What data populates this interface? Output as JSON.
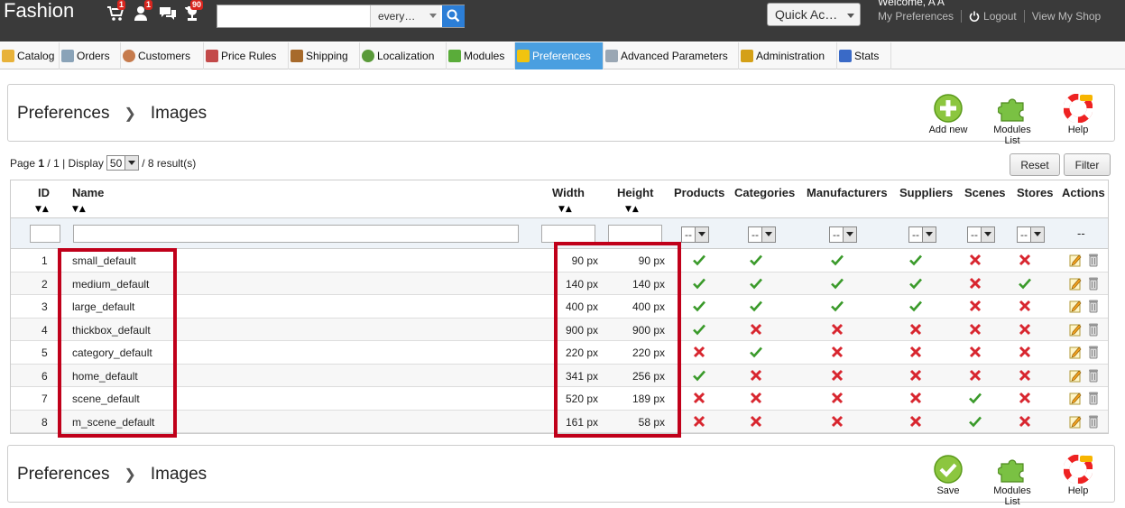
{
  "topbar": {
    "shop_name": "Fashion",
    "notifications": [
      {
        "icon": "cart-icon",
        "count": "1"
      },
      {
        "icon": "customer-icon",
        "count": "1"
      },
      {
        "icon": "message-icon",
        "count": ""
      },
      {
        "icon": "trophy-icon",
        "count": "90"
      }
    ],
    "search_value": "",
    "search_scope": "every…",
    "quick_access": "Quick Ac…",
    "welcome": "Welcome, A A",
    "my_preferences": "My Preferences",
    "logout": "Logout",
    "view_shop": "View My Shop"
  },
  "menu": [
    {
      "label": "Catalog",
      "color": "#e8b23a"
    },
    {
      "label": "Orders",
      "color": "#8aa3b8"
    },
    {
      "label": "Customers",
      "color": "#c67b4d"
    },
    {
      "label": "Price Rules",
      "color": "#c34a4a"
    },
    {
      "label": "Shipping",
      "color": "#a76a2b"
    },
    {
      "label": "Localization",
      "color": "#5a9a3a"
    },
    {
      "label": "Modules",
      "color": "#5aac3a"
    },
    {
      "label": "Preferences",
      "color": "#f1c40f"
    },
    {
      "label": "Advanced Parameters",
      "color": "#9aa7b4"
    },
    {
      "label": "Administration",
      "color": "#d4a017"
    },
    {
      "label": "Stats",
      "color": "#3a6ac7"
    }
  ],
  "breadcrumb": {
    "section": "Preferences",
    "page": "Images"
  },
  "toolbar_top": {
    "add_new": "Add new",
    "modules_list": "Modules List",
    "help": "Help"
  },
  "toolbar_bottom": {
    "save": "Save",
    "modules_list": "Modules List",
    "help": "Help"
  },
  "pager": {
    "page_label": "Page",
    "page": "1",
    "of": "/ 1",
    "display_label": "| Display",
    "per_page": "50",
    "results": "/ 8 result(s)"
  },
  "buttons": {
    "reset": "Reset",
    "filter": "Filter"
  },
  "columns": {
    "id": "ID",
    "name": "Name",
    "width": "Width",
    "height": "Height",
    "products": "Products",
    "categories": "Categories",
    "manufacturers": "Manufacturers",
    "suppliers": "Suppliers",
    "scenes": "Scenes",
    "stores": "Stores",
    "actions": "Actions"
  },
  "filter_select": "--",
  "actions_placeholder": "--",
  "rows": [
    {
      "id": "1",
      "name": "small_default",
      "width": "90 px",
      "height": "90 px",
      "products": true,
      "categories": true,
      "manufacturers": true,
      "suppliers": true,
      "scenes": false,
      "stores": false
    },
    {
      "id": "2",
      "name": "medium_default",
      "width": "140 px",
      "height": "140 px",
      "products": true,
      "categories": true,
      "manufacturers": true,
      "suppliers": true,
      "scenes": false,
      "stores": true
    },
    {
      "id": "3",
      "name": "large_default",
      "width": "400 px",
      "height": "400 px",
      "products": true,
      "categories": true,
      "manufacturers": true,
      "suppliers": true,
      "scenes": false,
      "stores": false
    },
    {
      "id": "4",
      "name": "thickbox_default",
      "width": "900 px",
      "height": "900 px",
      "products": true,
      "categories": false,
      "manufacturers": false,
      "suppliers": false,
      "scenes": false,
      "stores": false
    },
    {
      "id": "5",
      "name": "category_default",
      "width": "220 px",
      "height": "220 px",
      "products": false,
      "categories": true,
      "manufacturers": false,
      "suppliers": false,
      "scenes": false,
      "stores": false
    },
    {
      "id": "6",
      "name": "home_default",
      "width": "341 px",
      "height": "256 px",
      "products": true,
      "categories": false,
      "manufacturers": false,
      "suppliers": false,
      "scenes": false,
      "stores": false
    },
    {
      "id": "7",
      "name": "scene_default",
      "width": "520 px",
      "height": "189 px",
      "products": false,
      "categories": false,
      "manufacturers": false,
      "suppliers": false,
      "scenes": true,
      "stores": false
    },
    {
      "id": "8",
      "name": "m_scene_default",
      "width": "161 px",
      "height": "58 px",
      "products": false,
      "categories": false,
      "manufacturers": false,
      "suppliers": false,
      "scenes": true,
      "stores": false
    }
  ],
  "colors": {
    "check": "#3a9a2a",
    "cross": "#d8262f",
    "highlight": "#c0001a",
    "active_tab": "#4a9fe0"
  }
}
